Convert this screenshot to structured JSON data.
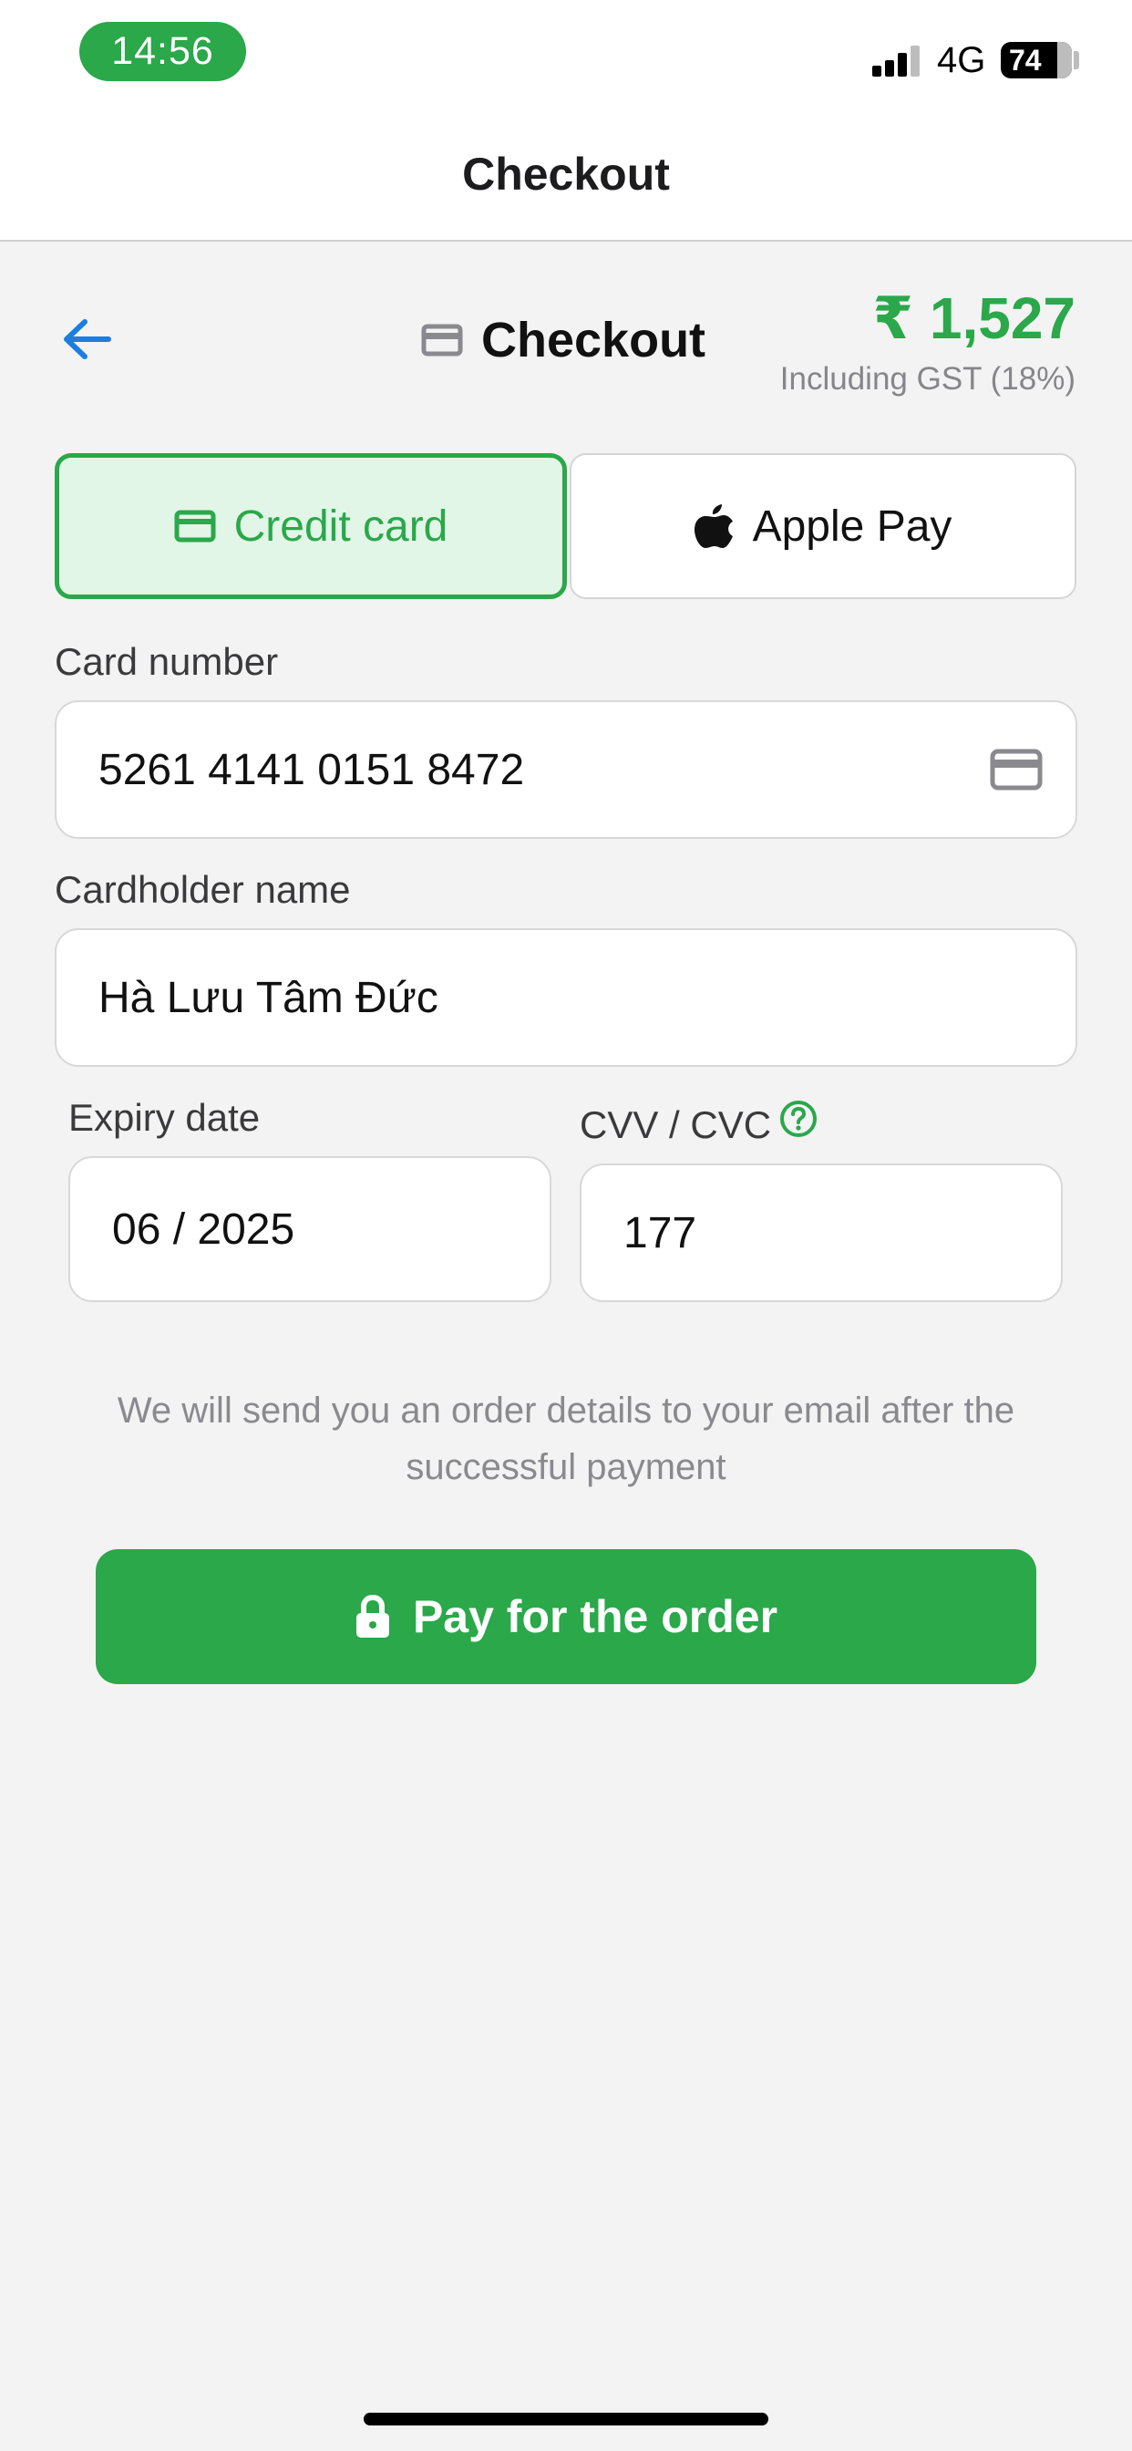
{
  "status_bar": {
    "time": "14:56",
    "network": "4G",
    "battery": "74"
  },
  "nav": {
    "title": "Checkout"
  },
  "header": {
    "title": "Checkout",
    "price": "₹ 1,527",
    "price_note": "Including GST (18%)"
  },
  "payment_methods": {
    "credit_card": "Credit card",
    "apple_pay": "Apple Pay",
    "selected": "credit_card"
  },
  "form": {
    "card_number_label": "Card number",
    "card_number_value": "5261 4141 0151 8472",
    "cardholder_label": "Cardholder name",
    "cardholder_value": "Hà Lưu Tâm Đức",
    "expiry_label": "Expiry date",
    "expiry_value": "06 / 2025",
    "cvv_label": "CVV / CVC",
    "cvv_value": "177"
  },
  "note": "We will send you an order details to your email after the successful payment",
  "pay_button": "Pay for the order",
  "colors": {
    "accent": "#2aa84a",
    "accent_light": "#e2f6e7",
    "link_blue": "#1a7fe0",
    "background": "#f3f3f3"
  },
  "icons": [
    "back-arrow-icon",
    "card-icon",
    "apple-icon",
    "help-icon",
    "lock-icon",
    "signal-icon",
    "battery-icon"
  ]
}
